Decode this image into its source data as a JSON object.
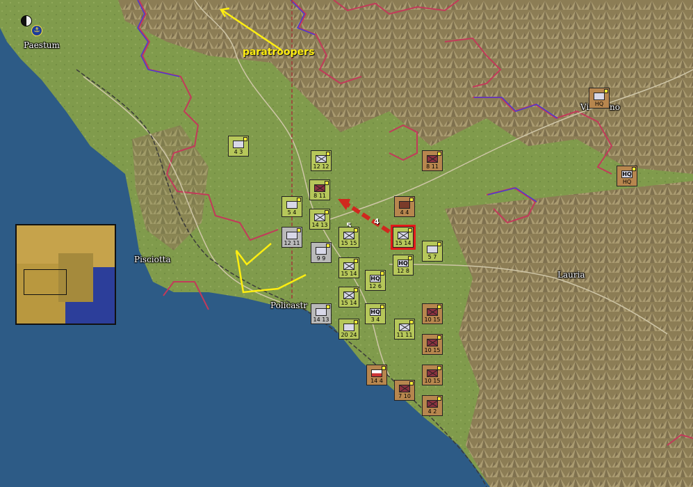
{
  "places": {
    "paestum": "Paestum",
    "pisciotta": "Pisciotta",
    "policastro": "Policastr",
    "lauria": "Lauria",
    "vibonati": "Vi",
    "vibonati_end": "no"
  },
  "annotations": {
    "paratroopers": "paratroopers",
    "move_cost_5": "5",
    "move_cost_4": "4"
  },
  "colors": {
    "sea": "#2d5b86",
    "coast_plain": "#7d9a4b",
    "mountains": "#9b8d5c",
    "front_line": "#c23a5a",
    "annotation": "#ffee10"
  },
  "units": [
    {
      "id": "u1",
      "label": "4 3",
      "type": "recon",
      "color": "green"
    },
    {
      "id": "u2",
      "label": "12 12",
      "type": "infantry",
      "color": "green"
    },
    {
      "id": "u3",
      "label": "8 11",
      "type": "armor",
      "color": "green"
    },
    {
      "id": "u4",
      "label": "8 11",
      "type": "armor",
      "color": "brown"
    },
    {
      "id": "u5",
      "label": "5 4",
      "type": "recon",
      "color": "green"
    },
    {
      "id": "u6",
      "label": "14 13",
      "type": "infantry",
      "color": "green"
    },
    {
      "id": "u7",
      "label": "12 11",
      "type": "artillery",
      "color": "grey"
    },
    {
      "id": "u8",
      "label": "9 9",
      "type": "armor",
      "color": "grey"
    },
    {
      "id": "u9",
      "label": "15 15",
      "type": "infantry",
      "color": "green"
    },
    {
      "id": "u10",
      "label": "15 14",
      "type": "infantry",
      "color": "green"
    },
    {
      "id": "u11",
      "label": "12 6",
      "type": "hq",
      "color": "green"
    },
    {
      "id": "u12",
      "label": "12 8",
      "type": "hq",
      "color": "green"
    },
    {
      "id": "u13",
      "label": "5 7",
      "type": "recon",
      "color": "green"
    },
    {
      "id": "u14",
      "label": "15 14",
      "type": "infantry",
      "color": "green"
    },
    {
      "id": "u15",
      "label": "15 14",
      "type": "infantry",
      "color": "green"
    },
    {
      "id": "u16",
      "label": "3 4",
      "type": "hq",
      "color": "green"
    },
    {
      "id": "u17",
      "label": "14 13",
      "type": "armor",
      "color": "grey"
    },
    {
      "id": "u18",
      "label": "20 24",
      "type": "armor",
      "color": "green"
    },
    {
      "id": "u19",
      "label": "11 11",
      "type": "infantry",
      "color": "green"
    },
    {
      "id": "u20",
      "label": "10 15",
      "type": "armor",
      "color": "brown"
    },
    {
      "id": "u21",
      "label": "10 15",
      "type": "armor",
      "color": "brown"
    },
    {
      "id": "u22",
      "label": "10 15",
      "type": "armor",
      "color": "brown"
    },
    {
      "id": "u23",
      "label": "14 4",
      "type": "flag",
      "color": "brown"
    },
    {
      "id": "u24",
      "label": "7 10",
      "type": "armor",
      "color": "brown"
    },
    {
      "id": "u25",
      "label": "4 2",
      "type": "armor",
      "color": "brown"
    },
    {
      "id": "u26",
      "label": "4 4",
      "type": "artillery",
      "color": "brown"
    },
    {
      "id": "u27",
      "label": "HQ",
      "type": "hq",
      "color": "brown"
    },
    {
      "id": "u28",
      "label": "HQ",
      "type": "hq",
      "color": "brown"
    }
  ],
  "minimap": {
    "label": "minimap"
  }
}
